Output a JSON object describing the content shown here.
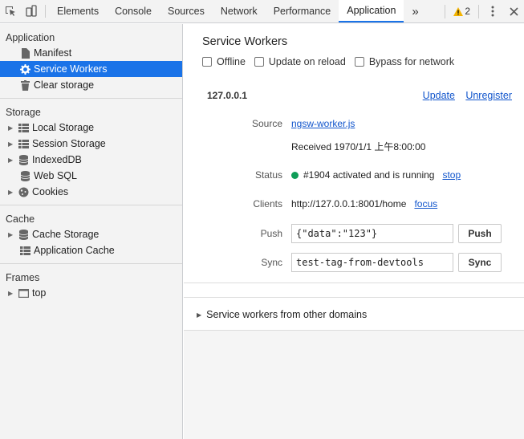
{
  "toolbar": {
    "tabs": [
      "Elements",
      "Console",
      "Sources",
      "Network",
      "Performance",
      "Application"
    ],
    "active_tab": "Application",
    "more_symbol": "»",
    "warning_count": "2"
  },
  "sidebar": {
    "application": {
      "title": "Application",
      "items": [
        {
          "label": "Manifest",
          "icon": "document-icon"
        },
        {
          "label": "Service Workers",
          "icon": "gear-icon",
          "selected": true
        },
        {
          "label": "Clear storage",
          "icon": "trash-icon"
        }
      ]
    },
    "storage": {
      "title": "Storage",
      "items": [
        {
          "label": "Local Storage",
          "icon": "grid-icon"
        },
        {
          "label": "Session Storage",
          "icon": "grid-icon"
        },
        {
          "label": "IndexedDB",
          "icon": "database-icon"
        },
        {
          "label": "Web SQL",
          "icon": "database-icon"
        },
        {
          "label": "Cookies",
          "icon": "cookie-icon"
        }
      ]
    },
    "cache": {
      "title": "Cache",
      "items": [
        {
          "label": "Cache Storage",
          "icon": "database-icon"
        },
        {
          "label": "Application Cache",
          "icon": "grid-icon"
        }
      ]
    },
    "frames": {
      "title": "Frames",
      "items": [
        {
          "label": "top",
          "icon": "frame-icon"
        }
      ]
    }
  },
  "main": {
    "title": "Service Workers",
    "checkboxes": {
      "offline": "Offline",
      "update_on_reload": "Update on reload",
      "bypass": "Bypass for network"
    },
    "origin": "127.0.0.1",
    "update_link": "Update",
    "unregister_link": "Unregister",
    "source_label": "Source",
    "source_file": "ngsw-worker.js",
    "received": "Received 1970/1/1 上午8:00:00",
    "status_label": "Status",
    "status_text": "#1904 activated and is running",
    "stop_link": "stop",
    "clients_label": "Clients",
    "clients_url": "http://127.0.0.1:8001/home",
    "focus_link": "focus",
    "push_label": "Push",
    "push_value": "{\"data\":\"123\"}",
    "push_button": "Push",
    "sync_label": "Sync",
    "sync_value": "test-tag-from-devtools",
    "sync_button": "Sync",
    "other_domains": "Service workers from other domains"
  },
  "colors": {
    "accent": "#1a73e8",
    "link": "#1155cc",
    "status_ok": "#0f9d58",
    "warning": "#f4b400"
  }
}
